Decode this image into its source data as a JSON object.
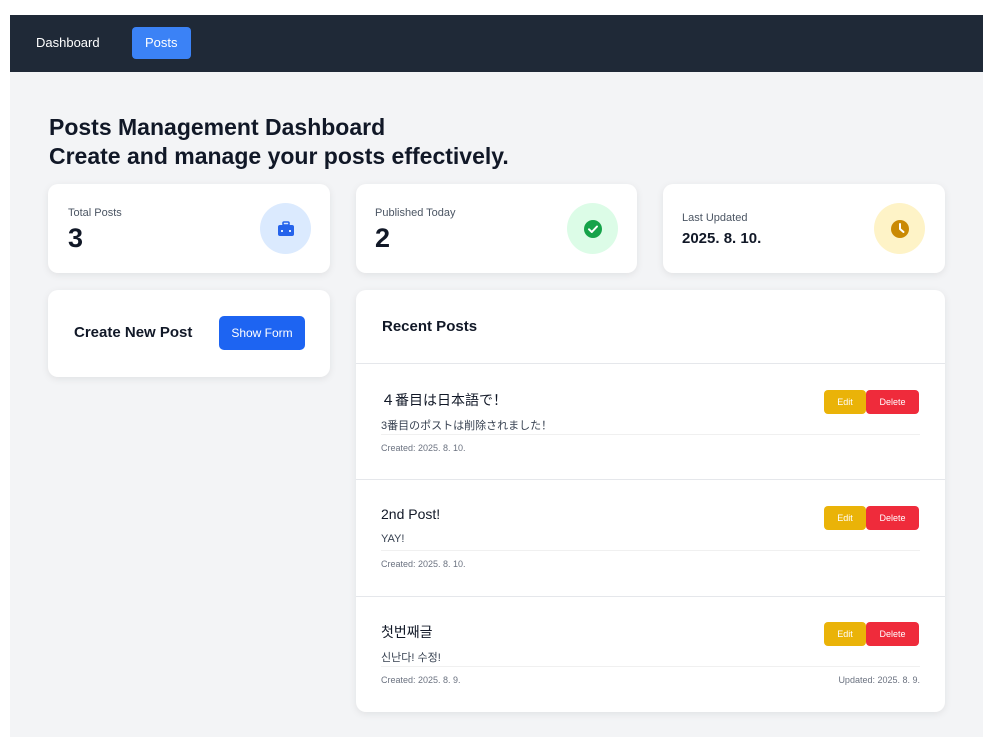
{
  "nav": {
    "dashboard_label": "Dashboard",
    "posts_label": "Posts"
  },
  "header": {
    "title": "Posts Management Dashboard",
    "subtitle": "Create and manage your posts effectively."
  },
  "stats": {
    "total": {
      "label": "Total Posts",
      "value": "3",
      "icon": "briefcase-icon"
    },
    "published": {
      "label": "Published Today",
      "value": "2",
      "icon": "check-circle-icon"
    },
    "updated": {
      "label": "Last Updated",
      "value": "2025. 8. 10.",
      "icon": "clock-icon"
    }
  },
  "create": {
    "title": "Create New Post",
    "button_label": "Show Form"
  },
  "recent": {
    "title": "Recent Posts",
    "edit_label": "Edit",
    "delete_label": "Delete",
    "posts": [
      {
        "title": "４番目は日本語で！",
        "body": "3番目のポストは削除されました！",
        "created": "Created: 2025. 8. 10.",
        "updated": ""
      },
      {
        "title": "2nd Post!",
        "body": "YAY!",
        "created": "Created: 2025. 8. 10.",
        "updated": ""
      },
      {
        "title": "첫번째글",
        "body": "신난다! 수정!",
        "created": "Created: 2025. 8. 9.",
        "updated": "Updated: 2025. 8. 9."
      }
    ]
  },
  "colors": {
    "nav_bg": "#1f2937",
    "accent": "#3b82f6",
    "primary_button": "#1d64f2",
    "edit": "#eab308",
    "delete": "#ef2b3b",
    "page_bg": "#f3f4f6"
  }
}
